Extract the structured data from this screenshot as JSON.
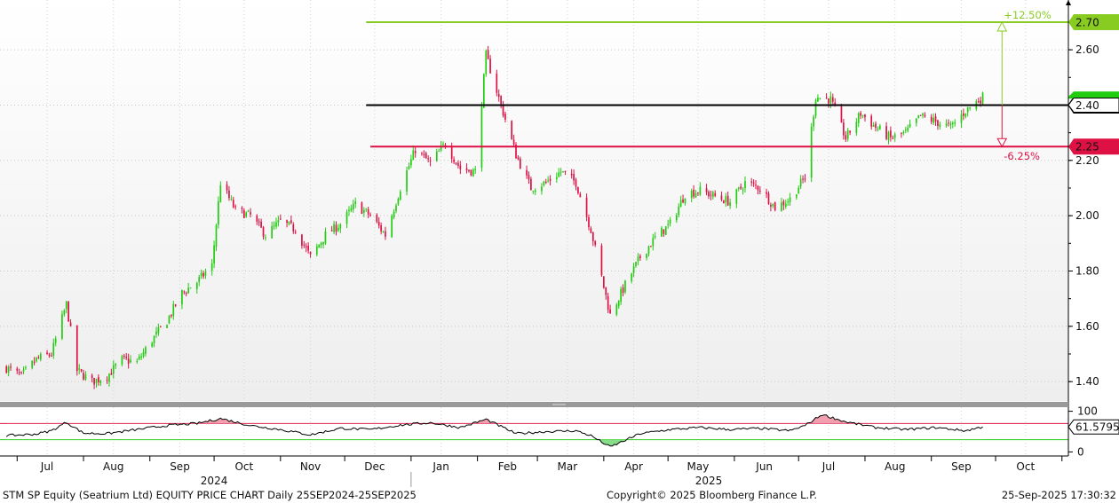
{
  "chart_data": {
    "type": "candlestick",
    "price_panel": {
      "ylim": [
        1.33,
        2.78
      ],
      "y_ticks": [
        "1.40",
        "1.60",
        "1.80",
        "2.00",
        "2.20",
        "2.60"
      ],
      "grid": true,
      "colors": {
        "up": "#22cc11",
        "down": "#dd1144"
      },
      "close_series": [
        {
          "d": "2024-06-26",
          "c": 1.45
        },
        {
          "d": "2024-07-03",
          "c": 1.42
        },
        {
          "d": "2024-07-10",
          "c": 1.48
        },
        {
          "d": "2024-07-17",
          "c": 1.5
        },
        {
          "d": "2024-07-24",
          "c": 1.68
        },
        {
          "d": "2024-07-29",
          "c": 1.44
        },
        {
          "d": "2024-08-05",
          "c": 1.4
        },
        {
          "d": "2024-08-12",
          "c": 1.42
        },
        {
          "d": "2024-08-19",
          "c": 1.48
        },
        {
          "d": "2024-08-26",
          "c": 1.47
        },
        {
          "d": "2024-09-02",
          "c": 1.55
        },
        {
          "d": "2024-09-09",
          "c": 1.62
        },
        {
          "d": "2024-09-16",
          "c": 1.72
        },
        {
          "d": "2024-09-23",
          "c": 1.76
        },
        {
          "d": "2024-09-30",
          "c": 1.82
        },
        {
          "d": "2024-10-04",
          "c": 2.12
        },
        {
          "d": "2024-10-11",
          "c": 2.02
        },
        {
          "d": "2024-10-18",
          "c": 2.0
        },
        {
          "d": "2024-10-25",
          "c": 1.93
        },
        {
          "d": "2024-11-01",
          "c": 1.98
        },
        {
          "d": "2024-11-08",
          "c": 1.95
        },
        {
          "d": "2024-11-15",
          "c": 1.85
        },
        {
          "d": "2024-11-22",
          "c": 1.93
        },
        {
          "d": "2024-11-29",
          "c": 1.97
        },
        {
          "d": "2024-12-06",
          "c": 2.04
        },
        {
          "d": "2024-12-13",
          "c": 2.0
        },
        {
          "d": "2024-12-20",
          "c": 1.93
        },
        {
          "d": "2024-12-27",
          "c": 2.1
        },
        {
          "d": "2025-01-03",
          "c": 2.24
        },
        {
          "d": "2025-01-10",
          "c": 2.19
        },
        {
          "d": "2025-01-17",
          "c": 2.26
        },
        {
          "d": "2025-01-24",
          "c": 2.17
        },
        {
          "d": "2025-01-31",
          "c": 2.16
        },
        {
          "d": "2025-02-05",
          "c": 2.58
        },
        {
          "d": "2025-02-12",
          "c": 2.4
        },
        {
          "d": "2025-02-19",
          "c": 2.22
        },
        {
          "d": "2025-02-26",
          "c": 2.1
        },
        {
          "d": "2025-03-05",
          "c": 2.12
        },
        {
          "d": "2025-03-12",
          "c": 2.16
        },
        {
          "d": "2025-03-19",
          "c": 2.12
        },
        {
          "d": "2025-03-26",
          "c": 1.95
        },
        {
          "d": "2025-04-04",
          "c": 1.64
        },
        {
          "d": "2025-04-11",
          "c": 1.75
        },
        {
          "d": "2025-04-18",
          "c": 1.85
        },
        {
          "d": "2025-04-25",
          "c": 1.92
        },
        {
          "d": "2025-05-02",
          "c": 1.97
        },
        {
          "d": "2025-05-09",
          "c": 2.08
        },
        {
          "d": "2025-05-16",
          "c": 2.09
        },
        {
          "d": "2025-05-23",
          "c": 2.07
        },
        {
          "d": "2025-05-30",
          "c": 2.05
        },
        {
          "d": "2025-06-06",
          "c": 2.12
        },
        {
          "d": "2025-06-13",
          "c": 2.1
        },
        {
          "d": "2025-06-20",
          "c": 2.03
        },
        {
          "d": "2025-06-27",
          "c": 2.06
        },
        {
          "d": "2025-07-04",
          "c": 2.14
        },
        {
          "d": "2025-07-09",
          "c": 2.43
        },
        {
          "d": "2025-07-16",
          "c": 2.42
        },
        {
          "d": "2025-07-23",
          "c": 2.28
        },
        {
          "d": "2025-07-30",
          "c": 2.37
        },
        {
          "d": "2025-08-06",
          "c": 2.32
        },
        {
          "d": "2025-08-13",
          "c": 2.28
        },
        {
          "d": "2025-08-20",
          "c": 2.3
        },
        {
          "d": "2025-08-27",
          "c": 2.36
        },
        {
          "d": "2025-09-03",
          "c": 2.34
        },
        {
          "d": "2025-09-10",
          "c": 2.32
        },
        {
          "d": "2025-09-17",
          "c": 2.38
        },
        {
          "d": "2025-09-25",
          "c": 2.43
        }
      ]
    },
    "levels": [
      {
        "value": 2.7,
        "label": "2.70",
        "color": "#88cc22",
        "start": "2024-12-11"
      },
      {
        "value": 2.4,
        "label": "2.40",
        "color": "#000000",
        "start": "2024-12-11"
      },
      {
        "value": 2.25,
        "label": "2.25",
        "color": "#dd1144",
        "start": "2024-12-13"
      }
    ],
    "last_price": 2.43,
    "range_arrow": {
      "date": "2025-10-04",
      "from": 2.4,
      "up_to": 2.7,
      "down_to": 2.25,
      "up_label": "+12.50%",
      "down_label": "-6.25%"
    },
    "rsi_panel": {
      "ylim": [
        -10,
        110
      ],
      "y_ticks": [
        "100",
        "0"
      ],
      "upper_band": 70,
      "lower_band": 30,
      "last_value": 61.5795,
      "last_label": "61.5795",
      "series": [
        {
          "d": "2024-06-26",
          "v": 40
        },
        {
          "d": "2024-07-10",
          "v": 44
        },
        {
          "d": "2024-07-17",
          "v": 52
        },
        {
          "d": "2024-07-24",
          "v": 73
        },
        {
          "d": "2024-08-01",
          "v": 46
        },
        {
          "d": "2024-08-12",
          "v": 45
        },
        {
          "d": "2024-08-26",
          "v": 55
        },
        {
          "d": "2024-09-09",
          "v": 65
        },
        {
          "d": "2024-09-23",
          "v": 70
        },
        {
          "d": "2024-10-04",
          "v": 82
        },
        {
          "d": "2024-10-18",
          "v": 65
        },
        {
          "d": "2024-11-01",
          "v": 55
        },
        {
          "d": "2024-11-15",
          "v": 42
        },
        {
          "d": "2024-11-29",
          "v": 58
        },
        {
          "d": "2024-12-13",
          "v": 55
        },
        {
          "d": "2024-12-27",
          "v": 66
        },
        {
          "d": "2025-01-10",
          "v": 72
        },
        {
          "d": "2025-01-24",
          "v": 60
        },
        {
          "d": "2025-02-05",
          "v": 80
        },
        {
          "d": "2025-02-19",
          "v": 45
        },
        {
          "d": "2025-03-05",
          "v": 50
        },
        {
          "d": "2025-03-19",
          "v": 52
        },
        {
          "d": "2025-03-26",
          "v": 40
        },
        {
          "d": "2025-04-04",
          "v": 12
        },
        {
          "d": "2025-04-18",
          "v": 45
        },
        {
          "d": "2025-05-02",
          "v": 55
        },
        {
          "d": "2025-05-16",
          "v": 60
        },
        {
          "d": "2025-05-30",
          "v": 55
        },
        {
          "d": "2025-06-13",
          "v": 58
        },
        {
          "d": "2025-06-27",
          "v": 52
        },
        {
          "d": "2025-07-04",
          "v": 65
        },
        {
          "d": "2025-07-12",
          "v": 92
        },
        {
          "d": "2025-07-23",
          "v": 74
        },
        {
          "d": "2025-08-06",
          "v": 60
        },
        {
          "d": "2025-08-20",
          "v": 55
        },
        {
          "d": "2025-09-03",
          "v": 60
        },
        {
          "d": "2025-09-17",
          "v": 52
        },
        {
          "d": "2025-09-25",
          "v": 61.5795
        }
      ]
    },
    "x_axis": {
      "month_labels": [
        "Jul",
        "Aug",
        "Sep",
        "Oct",
        "Nov",
        "Dec",
        "Jan",
        "Feb",
        "Mar",
        "Apr",
        "May",
        "Jun",
        "Jul",
        "Aug",
        "Sep",
        "Oct"
      ],
      "month_dates": [
        "2024-07-15",
        "2024-08-15",
        "2024-09-15",
        "2024-10-15",
        "2024-11-15",
        "2024-12-15",
        "2025-01-15",
        "2025-02-15",
        "2025-03-15",
        "2025-04-15",
        "2025-05-15",
        "2025-06-15",
        "2025-07-15",
        "2025-08-15",
        "2025-09-15",
        "2025-10-15"
      ],
      "year_labels": [
        "2024",
        "2025"
      ],
      "year_dates": [
        "2024-10-01",
        "2025-05-20"
      ],
      "range": [
        "2024-06-23",
        "2025-11-04"
      ]
    }
  },
  "footer": {
    "left": "STM SP Equity (Seatrium Ltd) EQUITY PRICE CHART  Daily 25SEP2024-25SEP2025",
    "center": "Copyright© 2025 Bloomberg Finance L.P.",
    "right": "25-Sep-2025 17:30:32"
  }
}
